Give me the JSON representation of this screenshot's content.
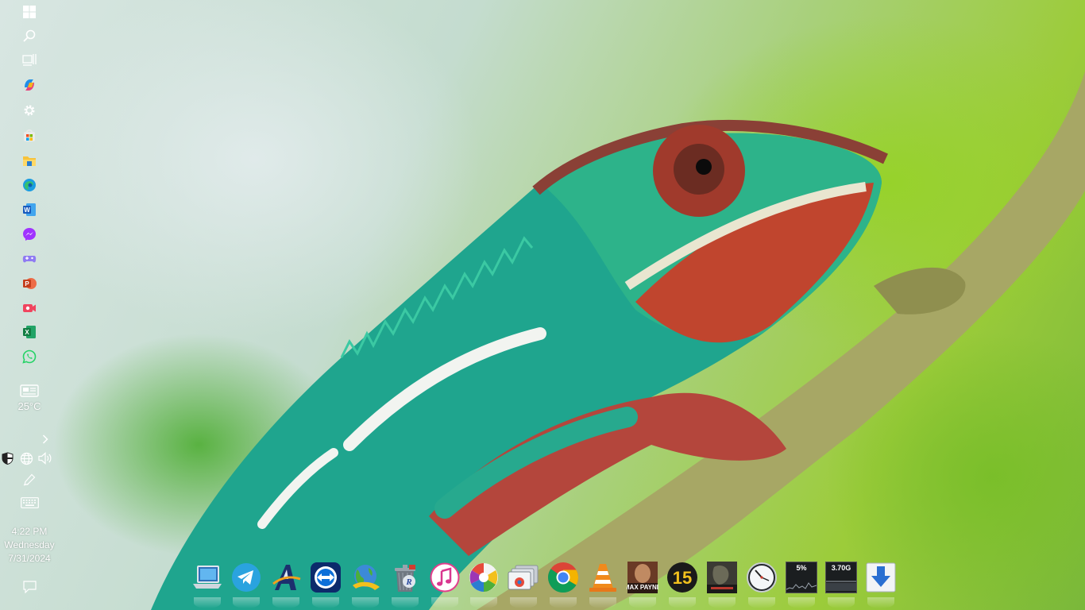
{
  "desktop": {
    "wallpaper": "chameleon-on-branch-wallpaper"
  },
  "taskbar": {
    "items": [
      {
        "name": "start-button",
        "icon": "windows-logo-icon"
      },
      {
        "name": "search-button",
        "icon": "search-icon"
      },
      {
        "name": "task-view-button",
        "icon": "task-view-icon"
      },
      {
        "name": "copilot-button",
        "icon": "copilot-icon"
      },
      {
        "name": "settings-button",
        "icon": "gear-icon"
      },
      {
        "name": "microsoft-store-button",
        "icon": "store-icon"
      },
      {
        "name": "file-explorer-button",
        "icon": "folder-icon"
      },
      {
        "name": "edge-button",
        "icon": "edge-icon"
      },
      {
        "name": "word-button",
        "icon": "word-icon"
      },
      {
        "name": "messenger-button",
        "icon": "messenger-icon"
      },
      {
        "name": "game-button",
        "icon": "gamepad-icon"
      },
      {
        "name": "powerpoint-button",
        "icon": "powerpoint-icon"
      },
      {
        "name": "clipchamp-button",
        "icon": "camera-icon"
      },
      {
        "name": "excel-button",
        "icon": "excel-icon"
      },
      {
        "name": "whatsapp-button",
        "icon": "whatsapp-icon"
      }
    ],
    "weather": {
      "temperature": "25°C",
      "icon": "news-weather-icon"
    },
    "tray": {
      "overflow_icon": "chevron-right-icon",
      "security_icon": "shield-icon",
      "network_icon": "globe-icon",
      "volume_icon": "speaker-icon",
      "pen_icon": "pen-icon",
      "keyboard_icon": "keyboard-icon"
    },
    "clock": {
      "time": "4:22 PM",
      "day": "Wednesday",
      "date": "7/31/2024"
    },
    "notification_icon": "notification-icon"
  },
  "dock": {
    "items": [
      {
        "name": "this-pc",
        "icon": "laptop-icon"
      },
      {
        "name": "telegram",
        "icon": "telegram-icon"
      },
      {
        "name": "app-a",
        "icon": "a-logo-icon"
      },
      {
        "name": "teamviewer",
        "icon": "teamviewer-icon"
      },
      {
        "name": "internet-download-manager",
        "icon": "globe-download-icon"
      },
      {
        "name": "recycle-bin",
        "icon": "recycle-bin-icon"
      },
      {
        "name": "itunes",
        "icon": "music-note-icon"
      },
      {
        "name": "picasa",
        "icon": "picasa-icon"
      },
      {
        "name": "window-manager",
        "icon": "windows-stack-icon"
      },
      {
        "name": "chrome",
        "icon": "chrome-icon"
      },
      {
        "name": "vlc",
        "icon": "vlc-cone-icon"
      },
      {
        "name": "max-payne-3",
        "icon": "max-payne-icon"
      },
      {
        "name": "app-15",
        "icon": "number-15-icon"
      },
      {
        "name": "crysis",
        "icon": "game-cover-icon"
      },
      {
        "name": "clock-widget",
        "icon": "clock-icon"
      },
      {
        "name": "cpu-meter",
        "icon": "cpu-meter-icon",
        "label": "5%"
      },
      {
        "name": "memory-meter",
        "icon": "memory-meter-icon",
        "label": "3.70G"
      },
      {
        "name": "downloads",
        "icon": "download-arrow-icon"
      }
    ]
  }
}
